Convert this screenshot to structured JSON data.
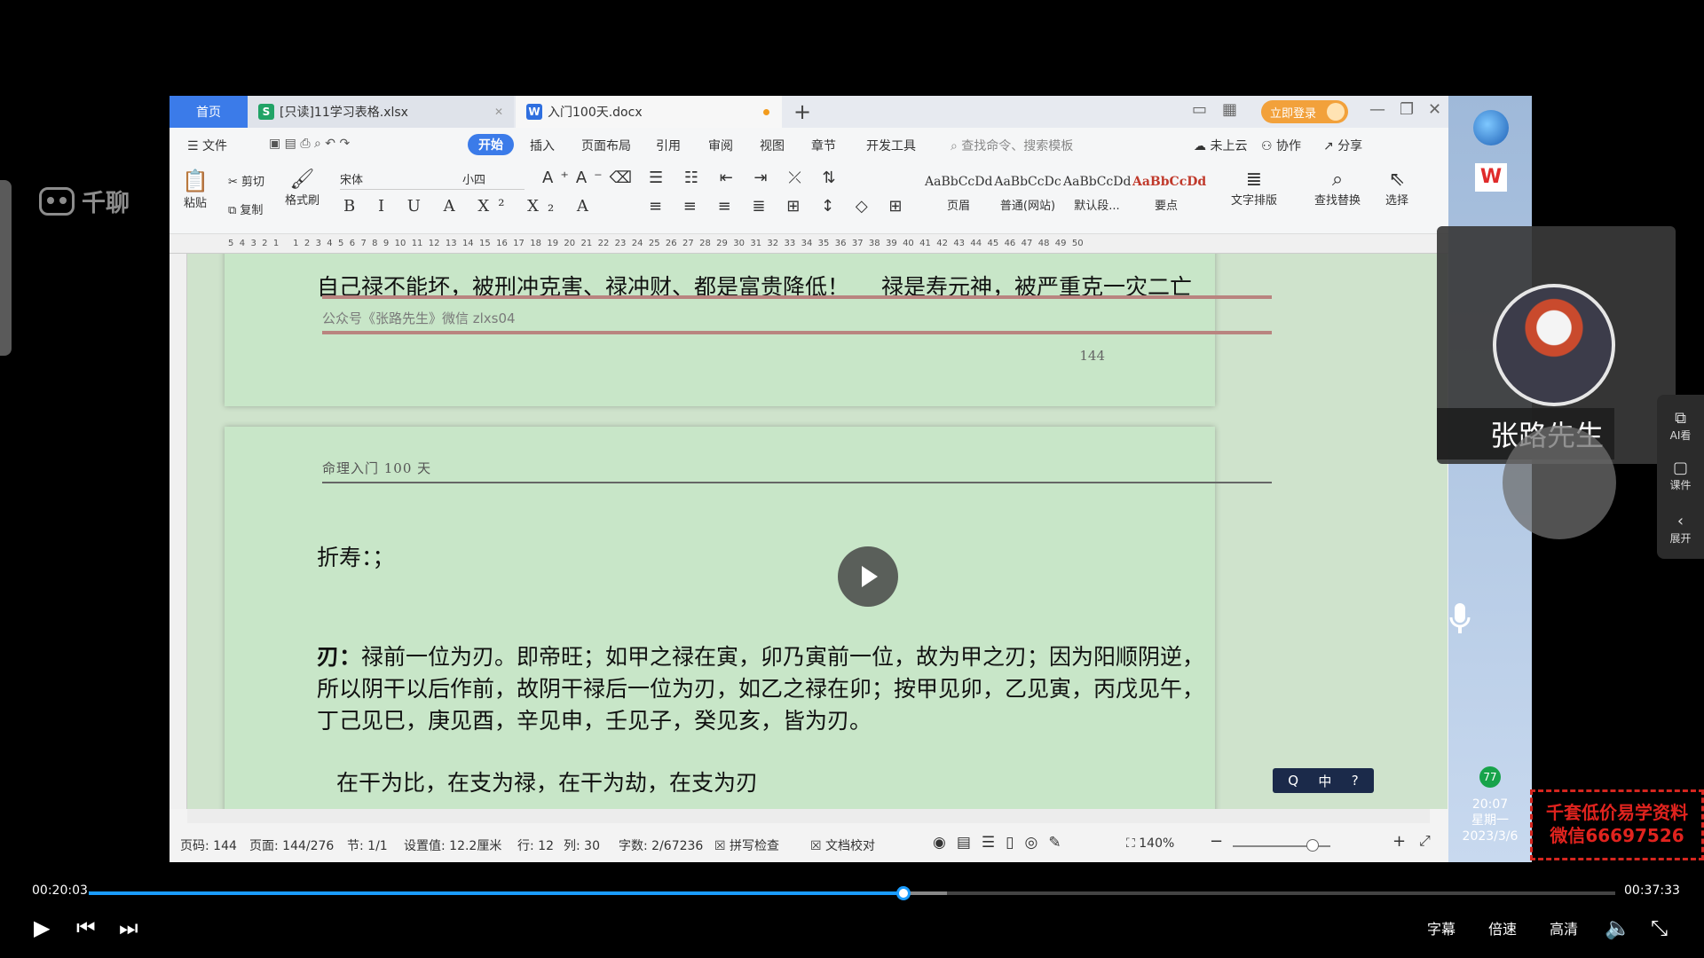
{
  "player": {
    "brand": "千聊",
    "time_current": "00:20:03",
    "time_total": "00:37:33",
    "progress": 0.534,
    "buffered": 0.562,
    "controls": {
      "subtitle": "字幕",
      "speed": "倍速",
      "quality": "高清"
    }
  },
  "wps": {
    "tabs": {
      "home": "首页",
      "xlsx": "[只读]11学习表格.xlsx",
      "docx": "入门100天.docx"
    },
    "login": "立即登录",
    "menu": {
      "file": "文件",
      "start": "开始",
      "insert": "插入",
      "layout": "页面布局",
      "ref": "引用",
      "review": "审阅",
      "view": "视图",
      "chapter": "章节",
      "dev": "开发工具",
      "search_placeholder": "查找命令、搜索模板",
      "cloud": "未上云",
      "collab": "协作",
      "share": "分享"
    },
    "ribbon": {
      "paste": "粘贴",
      "cut": "剪切",
      "copy": "复制",
      "format_painter": "格式刷",
      "font": "宋体",
      "size": "小四",
      "styles": [
        {
          "sample": "AaBbCcDd",
          "name": "页眉"
        },
        {
          "sample": "AaBbCcDc",
          "name": "普通(网站)"
        },
        {
          "sample": "AaBbCcDd",
          "name": "默认段..."
        },
        {
          "sample": "AaBbCcDd",
          "name": "要点"
        }
      ],
      "text_layout": "文字排版",
      "find_replace": "查找替换",
      "select": "选择"
    },
    "ruler_ticks": "5  4  3  2  1     1  2  3  4  5  6  7  8  9  10  11  12  13  14  15  16  17  18  19  20  21  22  23  24  25  26  27  28  29  30  31  32  33  34  35  36  37  38  39  40  41  42  43  44  45  46  47  48  49  50",
    "doc": {
      "page1_line": "自己禄不能坏，被刑冲克害、禄冲财、都是富贵降低！",
      "page1_line_underlined": "禄是寿元神，",
      "page1_line_tail": "被严重克一灾二亡",
      "footer_note": "公众号《张路先生》微信 zlxs04",
      "page_number": "144",
      "page2_header": "命理入门 100 天",
      "heading": "折寿：；",
      "para_lead": "刃：",
      "para_line1": "禄前一位为刃。即帝旺；如甲之禄在寅，卯乃寅前一位，故为甲之刃；因为阳顺阴逆，",
      "para_line2": "所以阴干以后作前，故阴干禄后一位为刃，如乙之禄在卯；按甲见卯，乙见寅，丙戊见午，",
      "para_line3": "丁己见巳，庚见酉，辛见申，壬见子，癸见亥，皆为刃。",
      "para_line4": "在干为比，在支为禄，在干为劫，在支为刃"
    },
    "ime": "中",
    "status": {
      "page_code": "页码: 144",
      "pages": "页面: 144/276",
      "section": "节: 1/1",
      "setting": "设置值: 12.2厘米",
      "row": "行: 12",
      "col": "列: 30",
      "words": "字数: 2/67236",
      "spell": "拼写检查",
      "proof": "文档校对",
      "zoom": "140%"
    }
  },
  "taskbar": {
    "badge": "77",
    "time": "20:07",
    "weekday": "星期一",
    "date": "2023/3/6"
  },
  "speaker": {
    "name": "张路先生"
  },
  "side_tools": {
    "ai": "AI看",
    "course": "课件",
    "expand": "展开"
  },
  "promo": {
    "line1": "千套低价易学资料",
    "line2": "微信66697526"
  }
}
